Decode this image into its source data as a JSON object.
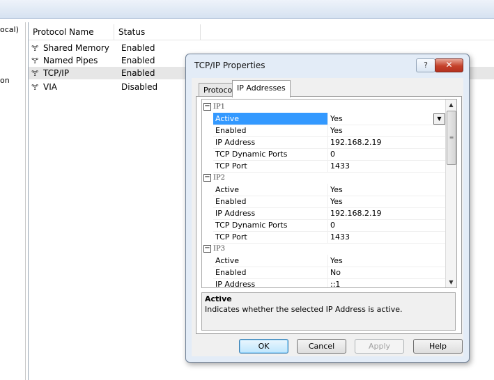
{
  "left_tree": {
    "items": [
      "ocal)",
      "",
      "on"
    ]
  },
  "list": {
    "columns": [
      "Protocol Name",
      "Status"
    ],
    "rows": [
      {
        "name": "Shared Memory",
        "status": "Enabled"
      },
      {
        "name": "Named Pipes",
        "status": "Enabled"
      },
      {
        "name": "TCP/IP",
        "status": "Enabled"
      },
      {
        "name": "VIA",
        "status": "Disabled"
      }
    ]
  },
  "dialog": {
    "title": "TCP/IP Properties",
    "help_label": "?",
    "close_label": "✕",
    "tabs": [
      "Protocol",
      "IP Addresses"
    ],
    "grid": {
      "groups": [
        {
          "name": "IP1",
          "props": [
            {
              "name": "Active",
              "value": "Yes"
            },
            {
              "name": "Enabled",
              "value": "Yes"
            },
            {
              "name": "IP Address",
              "value": "192.168.2.19"
            },
            {
              "name": "TCP Dynamic Ports",
              "value": "0"
            },
            {
              "name": "TCP Port",
              "value": "1433"
            }
          ]
        },
        {
          "name": "IP2",
          "props": [
            {
              "name": "Active",
              "value": "Yes"
            },
            {
              "name": "Enabled",
              "value": "Yes"
            },
            {
              "name": "IP Address",
              "value": "192.168.2.19"
            },
            {
              "name": "TCP Dynamic Ports",
              "value": "0"
            },
            {
              "name": "TCP Port",
              "value": "1433"
            }
          ]
        },
        {
          "name": "IP3",
          "props": [
            {
              "name": "Active",
              "value": "Yes"
            },
            {
              "name": "Enabled",
              "value": "No"
            },
            {
              "name": "IP Address",
              "value": "::1"
            }
          ]
        }
      ]
    },
    "description": {
      "title": "Active",
      "text": "Indicates whether the selected IP Address is active."
    },
    "buttons": {
      "ok": "OK",
      "cancel": "Cancel",
      "apply": "Apply",
      "help": "Help"
    }
  },
  "icons": {
    "protocol": "protocol-icon",
    "collapse": "collapse-icon",
    "dropdown": "chevron-down-icon"
  },
  "colors": {
    "selection": "#3399ff",
    "close_button": "#c4412a"
  }
}
